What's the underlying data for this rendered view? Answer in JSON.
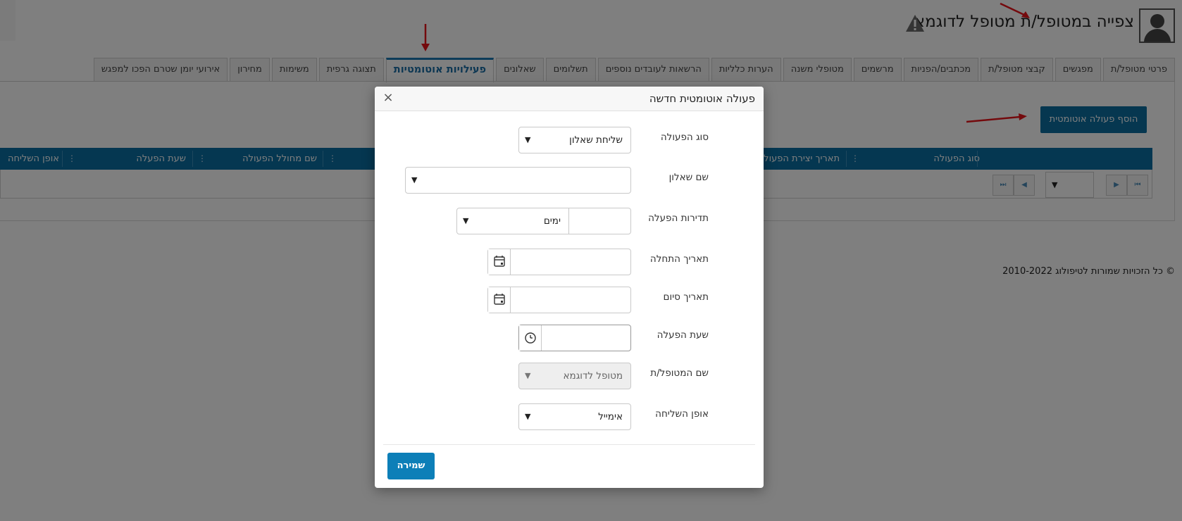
{
  "header": {
    "title": "צפייה במטופל/ת מטופל לדוגמא"
  },
  "tabs": [
    {
      "label": "פרטי מטופל/ת"
    },
    {
      "label": "מפגשים"
    },
    {
      "label": "קבצי מטופל/ת"
    },
    {
      "label": "מכתבים/הפניות"
    },
    {
      "label": "מרשמים"
    },
    {
      "label": "מטופלי משנה"
    },
    {
      "label": "הערות כלליות"
    },
    {
      "label": "הרשאות לעובדים נוספים"
    },
    {
      "label": "תשלומים"
    },
    {
      "label": "שאלונים"
    },
    {
      "label": "פעילויות אוטומטיות",
      "active": true
    },
    {
      "label": "תצוגה גרפית"
    },
    {
      "label": "משימות"
    },
    {
      "label": "מחירון"
    },
    {
      "label": "אירועי יומן שטרם הפכו למפגש"
    }
  ],
  "toolbar": {
    "add_button": "הוסף פעולה אוטומטית"
  },
  "grid": {
    "columns": [
      "סוג הפעולה",
      "תאריך יצירת הפעולה",
      "שם מחולל הפעולה",
      "שעת הפעלה",
      "אופן השליחה"
    ]
  },
  "footer": {
    "copyright": "© כל הזכויות שמורות לטיפולוג 2010-2022"
  },
  "modal": {
    "title": "פעולה אוטומטית חדשה",
    "close": "×",
    "fields": {
      "action_type": {
        "label": "סוג הפעולה",
        "value": "שליחת שאלון"
      },
      "questionnaire": {
        "label": "שם שאלון",
        "value": ""
      },
      "frequency": {
        "label": "תדירות הפעלה",
        "value": "",
        "unit": "ימים"
      },
      "start_date": {
        "label": "תאריך התחלה",
        "value": ""
      },
      "end_date": {
        "label": "תאריך סיום",
        "value": ""
      },
      "run_time": {
        "label": "שעת הפעלה",
        "value": ""
      },
      "patient_name": {
        "label": "שם המטופל/ת",
        "value": "מטופל לדוגמא"
      },
      "send_method": {
        "label": "אופן השליחה",
        "value": "אימייל"
      }
    },
    "save_button": "שמירה"
  },
  "colors": {
    "primary": "#0d6ea1",
    "active_tab": "#1b6fa6",
    "annotation_arrow": "#e8141b"
  }
}
